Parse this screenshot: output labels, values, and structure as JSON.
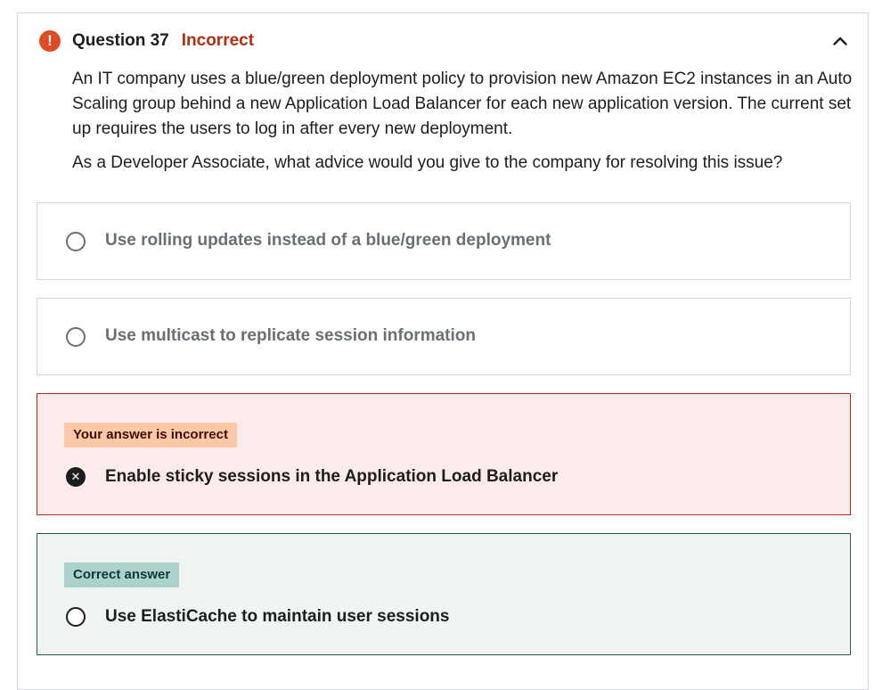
{
  "header": {
    "alert_icon": "exclamation-icon",
    "alert_glyph": "!",
    "question_number": "Question 37",
    "status": "Incorrect",
    "collapse_icon": "chevron-up-icon"
  },
  "question": {
    "paragraphs": [
      "An IT company uses a blue/green deployment policy to provision new Amazon EC2 instances in an Auto Scaling group behind a new Application Load Balancer for each new application version. The current set up requires the users to log in after every new deployment.",
      "As a Developer Associate, what advice would you give to the company for resolving this issue?"
    ]
  },
  "options": [
    {
      "label": "Use rolling updates instead of a blue/green deployment"
    },
    {
      "label": "Use multicast to replicate session information"
    },
    {
      "label": "Enable sticky sessions in the Application Load Balancer",
      "badge": "Your answer is incorrect",
      "icon": "x-circle-icon",
      "glyph": "✕"
    },
    {
      "label": "Use ElastiCache to maintain user sessions",
      "badge": "Correct answer"
    }
  ],
  "colors": {
    "alert": "#e14b23",
    "incorrect_text": "#b32d0f",
    "incorrect_bg": "#fbeceb",
    "incorrect_badge": "#fcc8a8",
    "correct_bg": "#f0f5f4",
    "correct_border": "#1e6055",
    "correct_badge": "#acd2cc"
  }
}
